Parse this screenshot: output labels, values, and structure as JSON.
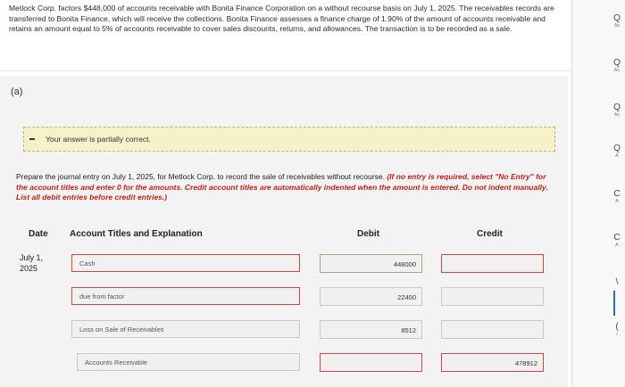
{
  "problem": {
    "text": "Metlock Corp. factors $448,000 of accounts receivable with Bonita Finance Corporation on a without recourse basis on July 1, 2025. The receivables records are transferred to Bonita Finance, which will receive the collections. Bonita Finance assesses a finance charge of 1.90% of the amount of accounts receivable and retains an amount equal to 5% of accounts receivable to cover sales discounts, returns, and allowances. The transaction is to be recorded as a sale."
  },
  "sidebar": {
    "items": [
      {
        "q": "Q",
        "sub": "Ac"
      },
      {
        "q": "Q",
        "sub": "Ac"
      },
      {
        "q": "Q",
        "sub": "Ac"
      },
      {
        "q": "Q",
        "sub": "A"
      },
      {
        "q": "C",
        "sub": "A"
      },
      {
        "q": "C",
        "sub": "A"
      },
      {
        "q": "\\",
        "sub": ""
      },
      {
        "q": "(",
        "sub": "/"
      }
    ]
  },
  "part": {
    "label": "(a)",
    "feedback": "Your answer is partially correct.",
    "instruction_main": "Prepare the journal entry on July 1, 2025, for Metlock Corp. to record the sale of receivables without recourse.",
    "instruction_note": "(If no entry is required, select \"No Entry\" for the account titles and enter 0 for the amounts. Credit account titles are automatically indented when the amount is entered. Do not indent manually. List all debit entries before credit entries.)"
  },
  "table": {
    "headers": {
      "date": "Date",
      "account": "Account Titles and Explanation",
      "debit": "Debit",
      "credit": "Credit"
    },
    "date_line1": "July 1,",
    "date_line2": "2025",
    "rows": [
      {
        "account": "Cash",
        "debit": "448000",
        "credit": ""
      },
      {
        "account": "due from factor",
        "debit": "22400",
        "credit": ""
      },
      {
        "account": "Loss on Sale of Receivables",
        "debit": "8512",
        "credit": ""
      },
      {
        "account": "Accounts Receivable",
        "debit": "",
        "credit": "478912"
      }
    ]
  }
}
